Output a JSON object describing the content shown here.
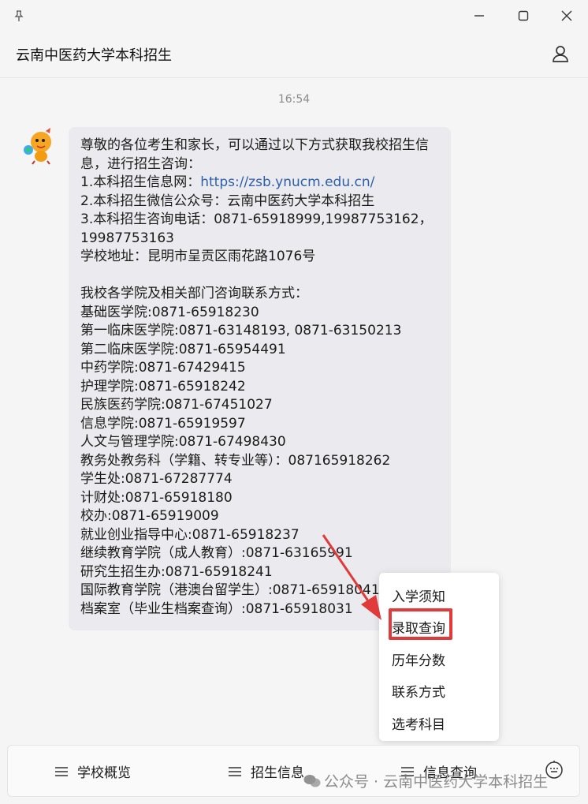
{
  "window": {
    "pin": "pin-icon",
    "minimize": "minimize-icon",
    "maximize": "maximize-icon",
    "close": "close-icon"
  },
  "header": {
    "title": "云南中医药大学本科招生"
  },
  "chat": {
    "time": "16:54",
    "message": {
      "intro1": "尊敬的各位考生和家长，可以通过以下方式获取我校招生信",
      "intro2": "息，进行招生咨询：",
      "item1_prefix": "1.本科招生信息网：",
      "item1_link": "https://zsb.ynucm.edu.cn/",
      "item2": "2.本科招生微信公众号：云南中医药大学本科招生",
      "item3a": "3.本科招生咨询电话：0871-65918999,19987753162，",
      "item3b": "19987753163",
      "address": "学校地址：昆明市呈贡区雨花路1076号",
      "dept_header": "我校各学院及相关部门咨询联系方式：",
      "contacts": [
        "基础医学院:0871-65918230",
        "第一临床医学院:0871-63148193, 0871-63150213",
        "第二临床医学院:0871-65954491",
        "中药学院:0871-67429415",
        "护理学院:0871-65918242",
        "民族医药学院:0871-67451027",
        "信息学院:0871-65919597",
        "人文与管理学院:0871-67498430",
        "教务处教务科（学籍、转专业等）：087165918262",
        "学生处:0871-67287774",
        "计财处:0871-65918180",
        "校办:0871-65919009",
        "就业创业指导中心:0871-65918237",
        "继续教育学院（成人教育）:0871-63165991",
        "研究生招生办:0871-65918241",
        "国际教育学院（港澳台留学生）:0871-65918041",
        "档案室（毕业生档案查询）:0871-65918031"
      ]
    }
  },
  "popup_menu": {
    "items": [
      "入学须知",
      "录取查询",
      "历年分数",
      "联系方式",
      "选考科目"
    ],
    "highlighted": "录取查询",
    "highlight_color": "#e03a3a"
  },
  "bottom_menu": {
    "items": [
      "学校概览",
      "招生信息",
      "信息查询"
    ]
  },
  "watermark": "公众号 · 云南中医药大学本科招生"
}
